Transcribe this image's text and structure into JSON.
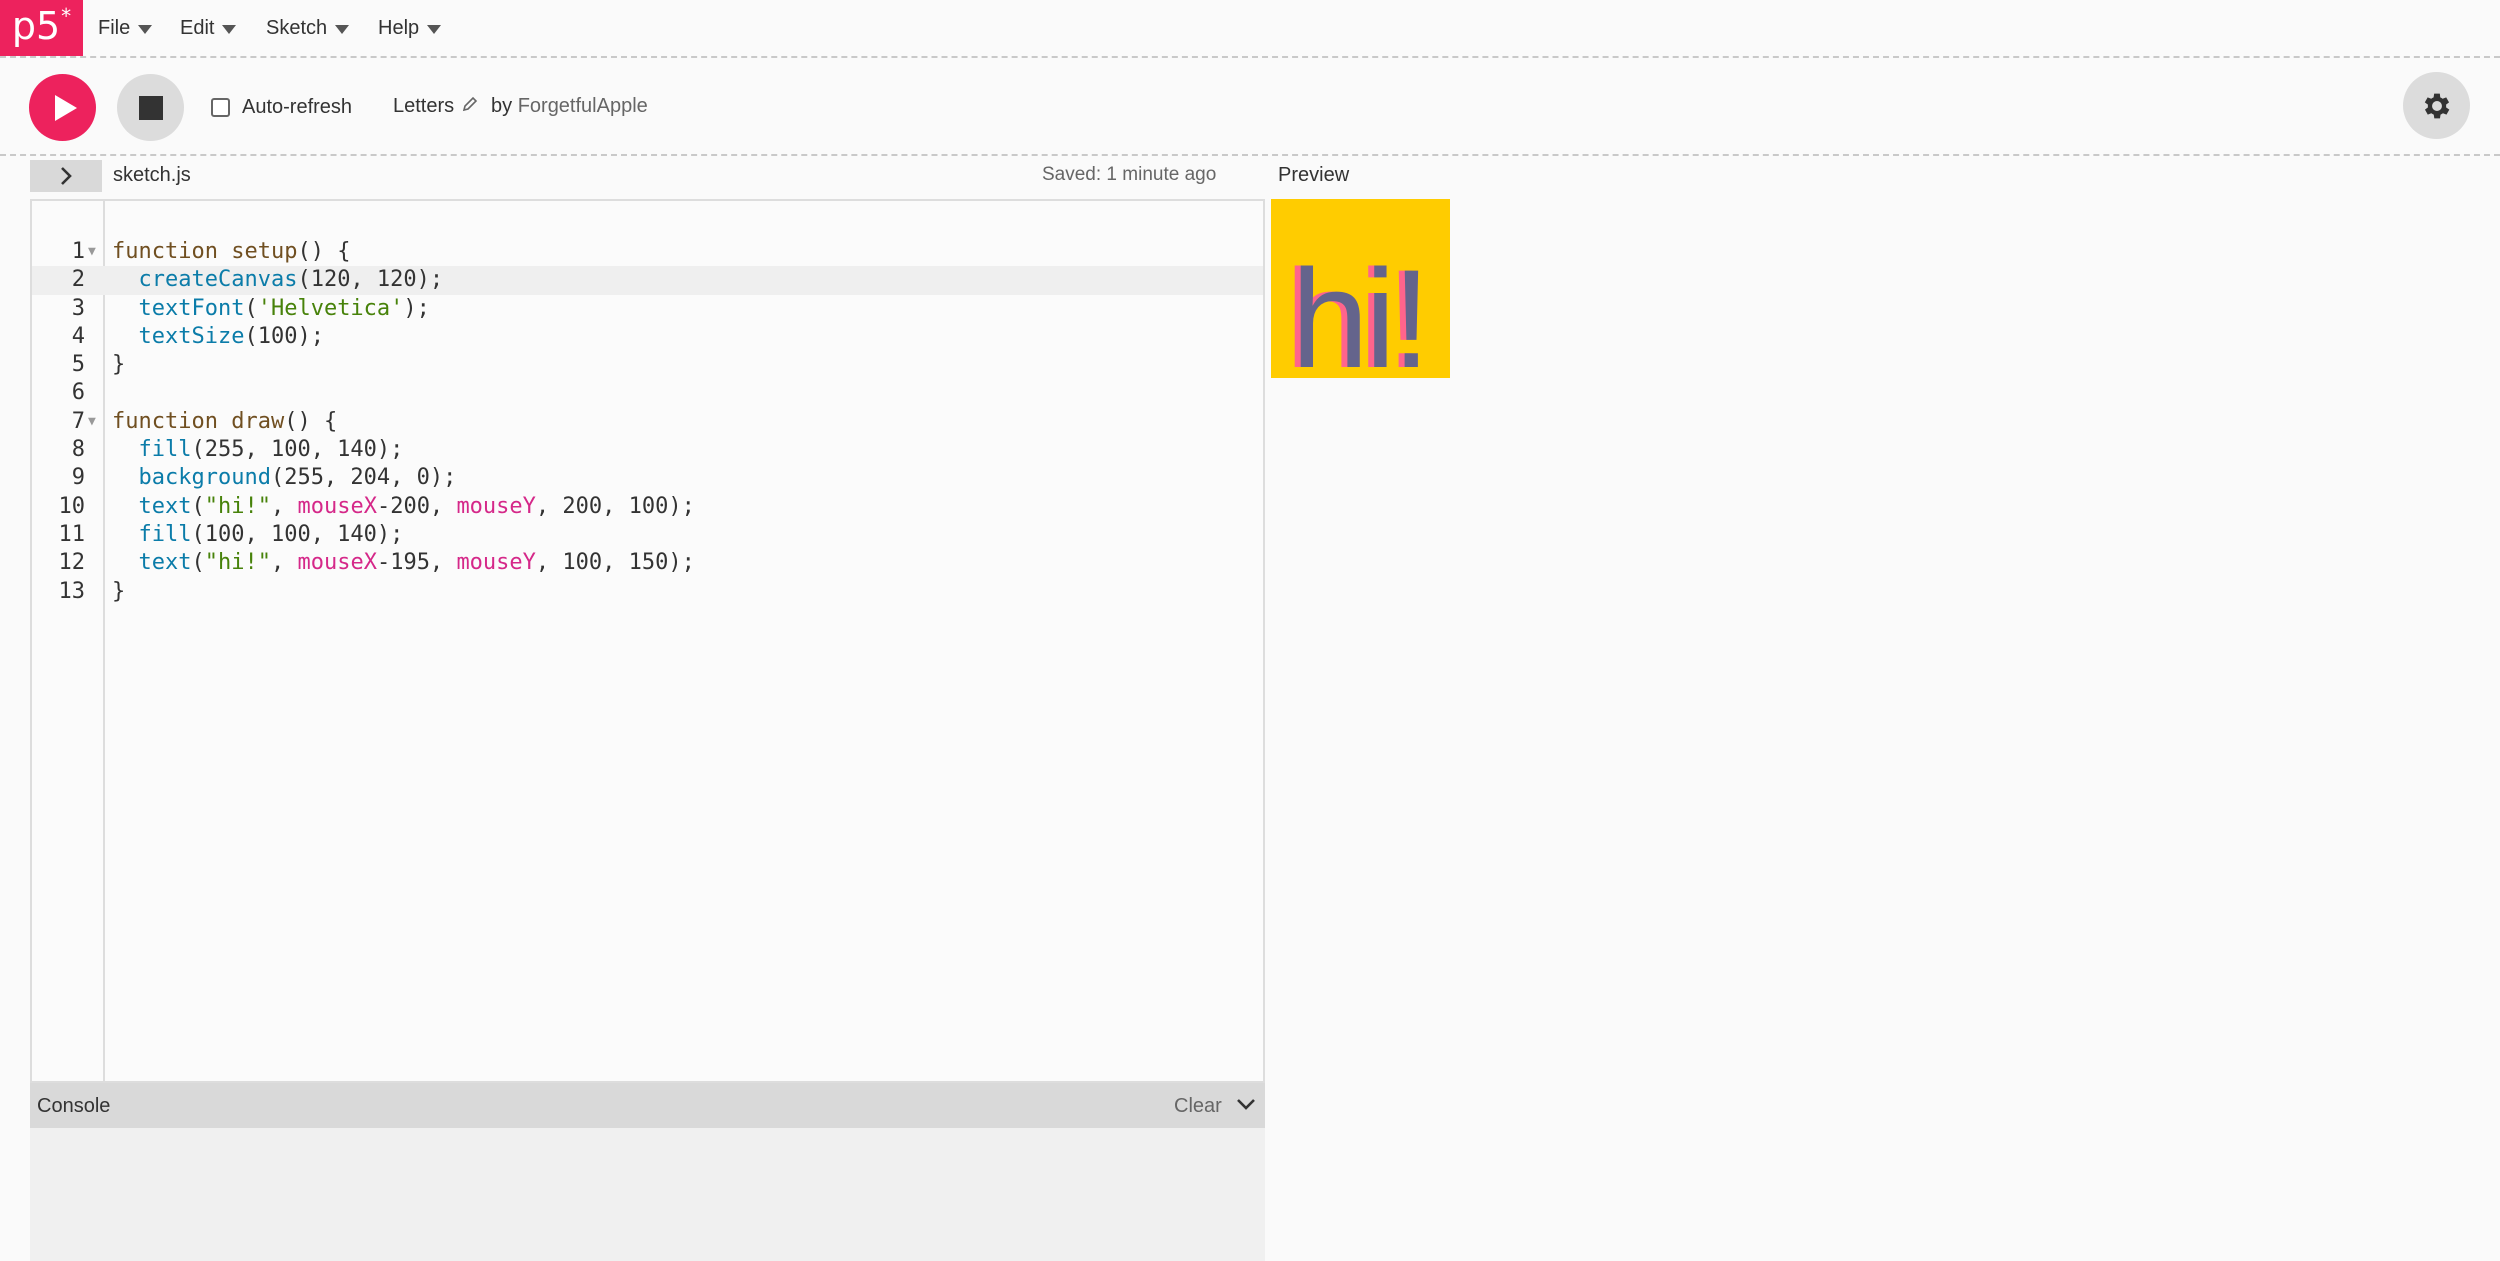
{
  "nav": {
    "logo": "p5",
    "logo_sup": "*",
    "menus": [
      {
        "label": "File"
      },
      {
        "label": "Edit"
      },
      {
        "label": "Sketch"
      },
      {
        "label": "Help"
      }
    ]
  },
  "toolbar": {
    "auto_refresh_label": "Auto-refresh",
    "auto_refresh_checked": false,
    "sketch_name": "Letters",
    "by_label": "by",
    "author": "ForgetfulApple"
  },
  "filebar": {
    "filename": "sketch.js",
    "saved_status": "Saved: 1 minute ago",
    "preview_label": "Preview"
  },
  "editor": {
    "active_line": 2,
    "lines": [
      {
        "n": "1",
        "fold": true
      },
      {
        "n": "2",
        "fold": false
      },
      {
        "n": "3",
        "fold": false
      },
      {
        "n": "4",
        "fold": false
      },
      {
        "n": "5",
        "fold": false
      },
      {
        "n": "6",
        "fold": false
      },
      {
        "n": "7",
        "fold": true
      },
      {
        "n": "8",
        "fold": false
      },
      {
        "n": "9",
        "fold": false
      },
      {
        "n": "10",
        "fold": false
      },
      {
        "n": "11",
        "fold": false
      },
      {
        "n": "12",
        "fold": false
      },
      {
        "n": "13",
        "fold": false
      }
    ],
    "tokens": {
      "l1": [
        "function",
        " ",
        "setup",
        "() {"
      ],
      "l2": [
        "  ",
        "createCanvas",
        "(120, 120);"
      ],
      "l3": [
        "  ",
        "textFont",
        "(",
        "'Helvetica'",
        ");"
      ],
      "l4": [
        "  ",
        "textSize",
        "(100);"
      ],
      "l5": [
        "}"
      ],
      "l6": [
        ""
      ],
      "l7": [
        "function",
        " ",
        "draw",
        "() {"
      ],
      "l8": [
        "  ",
        "fill",
        "(255, 100, 140);"
      ],
      "l9": [
        "  ",
        "background",
        "(255, 204, 0);"
      ],
      "l10": [
        "  ",
        "text",
        "(",
        "\"hi!\"",
        ", ",
        "mouseX",
        "-200, ",
        "mouseY",
        ", 200, 100);"
      ],
      "l11": [
        "  ",
        "fill",
        "(100, 100, 140);"
      ],
      "l12": [
        "  ",
        "text",
        "(",
        "\"hi!\"",
        ", ",
        "mouseX",
        "-195, ",
        "mouseY",
        ", 100, 150);"
      ],
      "l13": [
        "}"
      ]
    }
  },
  "console": {
    "title": "Console",
    "clear_label": "Clear"
  },
  "preview": {
    "background": "#ffcc00",
    "text": "hi!",
    "text_color_back": "#ff648c",
    "text_color_front": "#64648c"
  },
  "colors": {
    "accent": "#ed225d"
  }
}
